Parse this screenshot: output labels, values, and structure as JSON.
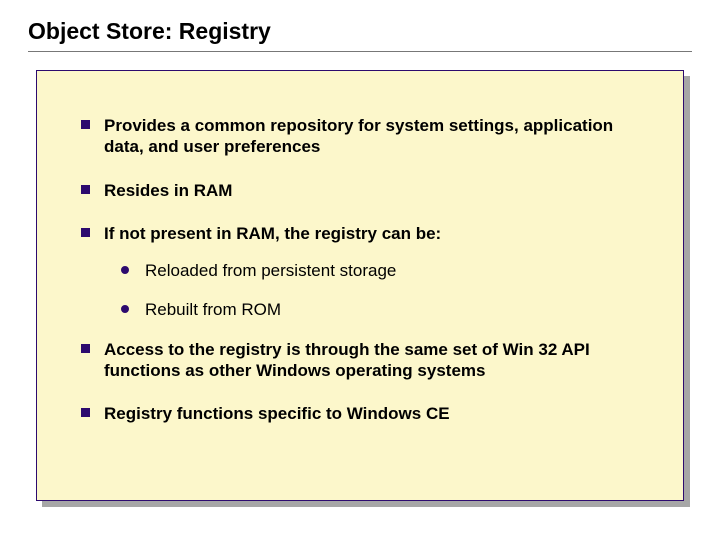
{
  "title": "Object Store: Registry",
  "bullets": {
    "b1": "Provides a common repository for system settings, application data, and user preferences",
    "b2": "Resides in RAM",
    "b3": "If not present in RAM, the registry can be:",
    "b3sub": {
      "s1": "Reloaded from persistent storage",
      "s2": "Rebuilt from ROM"
    },
    "b4": "Access to the registry is through the same set of Win 32 API functions as other Windows operating systems",
    "b5": "Registry functions specific to Windows CE"
  }
}
